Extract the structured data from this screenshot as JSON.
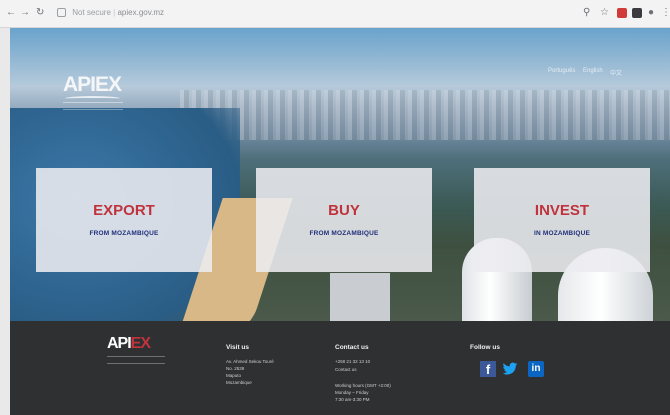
{
  "browser": {
    "back_icon": "back-arrow-icon",
    "forward_icon": "forward-arrow-icon",
    "reload_icon": "reload-icon",
    "url_prefix": "Not secure",
    "url": "apiex.gov.mz"
  },
  "header": {
    "logo": "APIEX",
    "language_links": [
      "Português",
      "English",
      "中文"
    ]
  },
  "cards": [
    {
      "title": "EXPORT",
      "subtitle": "FROM MOZAMBIQUE"
    },
    {
      "title": "BUY",
      "subtitle": "FROM MOZAMBIQUE"
    },
    {
      "title": "INVEST",
      "subtitle": "IN MOZAMBIQUE"
    }
  ],
  "footer": {
    "logo_main": "API",
    "logo_accent": "EX",
    "visit": {
      "title": "Visit us",
      "lines": [
        "Av. Ahmed Sekou Touré",
        "No. 2539",
        "Maputo",
        "Mozambique"
      ]
    },
    "contact": {
      "title": "Contact us",
      "lines": [
        "+258 21 32 13 10",
        "Contact us",
        "",
        "Working hours (GMT +2:00)",
        "Monday – Friday",
        "7:30 am-3:30 PM"
      ]
    },
    "follow": {
      "title": "Follow us",
      "facebook_label": "f",
      "linkedin_label": "in"
    }
  },
  "colors": {
    "accent_red": "#c0333c",
    "subtitle_blue": "#1f2f7a",
    "footer_bg": "#2f3032"
  }
}
